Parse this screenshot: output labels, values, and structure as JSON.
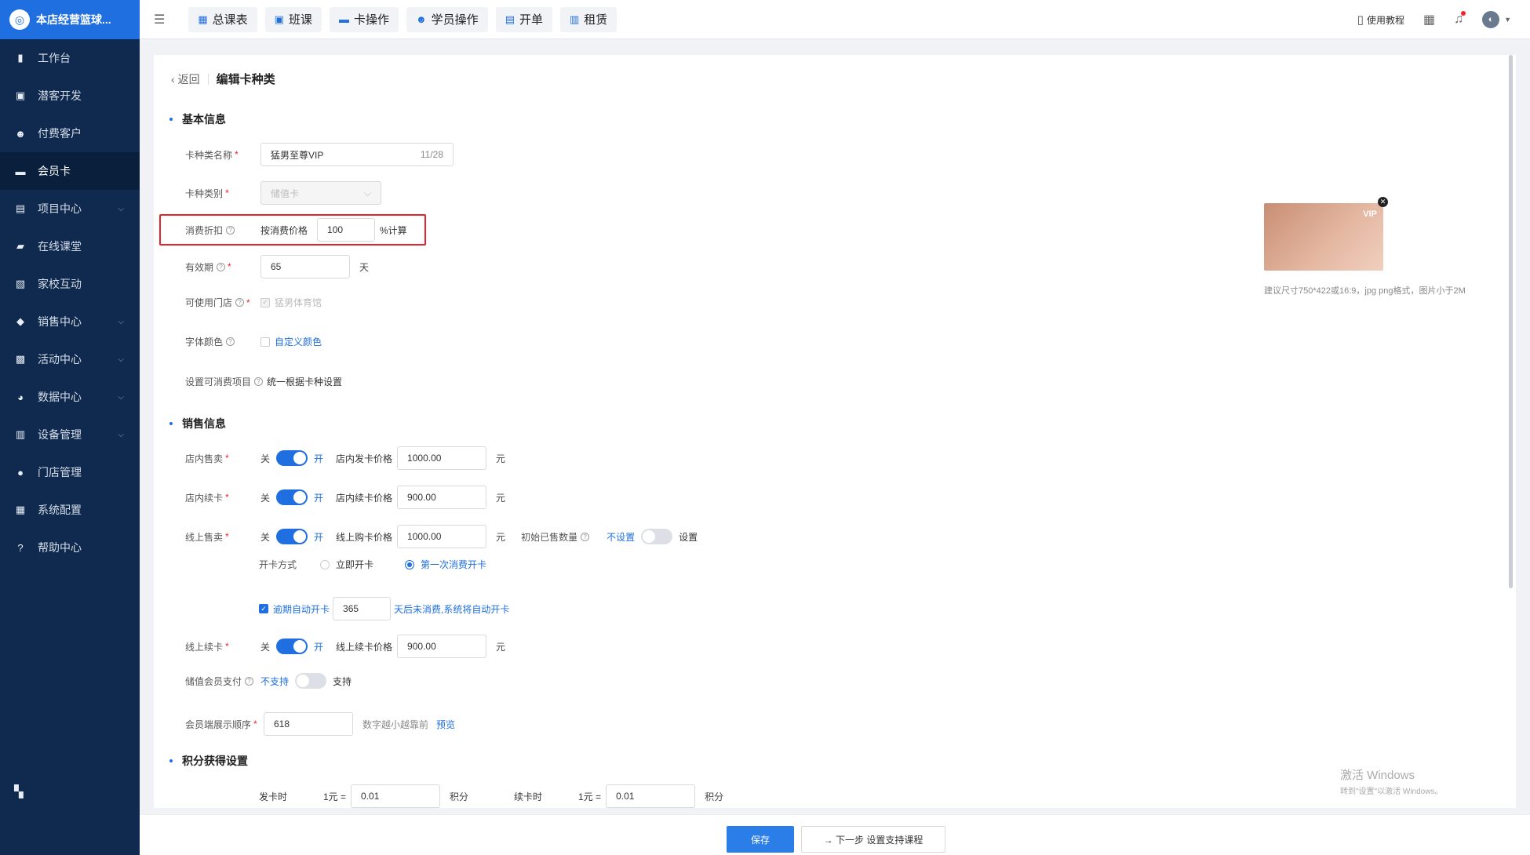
{
  "sidebar": {
    "brand": "本店经营篮球...",
    "items": [
      {
        "label": "工作台",
        "icon": "workbench-icon",
        "chevron": false
      },
      {
        "label": "潜客开发",
        "icon": "prospect-icon",
        "chevron": false
      },
      {
        "label": "付费客户",
        "icon": "customers-icon",
        "chevron": false
      },
      {
        "label": "会员卡",
        "icon": "card-icon",
        "chevron": false,
        "active": true
      },
      {
        "label": "项目中心",
        "icon": "project-icon",
        "chevron": true
      },
      {
        "label": "在线课堂",
        "icon": "classroom-icon",
        "chevron": false
      },
      {
        "label": "家校互动",
        "icon": "interaction-icon",
        "chevron": false
      },
      {
        "label": "销售中心",
        "icon": "sales-icon",
        "chevron": true
      },
      {
        "label": "活动中心",
        "icon": "activity-icon",
        "chevron": true
      },
      {
        "label": "数据中心",
        "icon": "data-icon",
        "chevron": true
      },
      {
        "label": "设备管理",
        "icon": "device-icon",
        "chevron": true
      },
      {
        "label": "门店管理",
        "icon": "store-icon",
        "chevron": false
      },
      {
        "label": "系统配置",
        "icon": "settings-icon",
        "chevron": false
      },
      {
        "label": "帮助中心",
        "icon": "help-icon",
        "chevron": false
      }
    ]
  },
  "header": {
    "tabs": [
      {
        "label": "总课表"
      },
      {
        "label": "班课"
      },
      {
        "label": "卡操作"
      },
      {
        "label": "学员操作"
      },
      {
        "label": "开单"
      },
      {
        "label": "租赁"
      }
    ],
    "tutorial": "使用教程"
  },
  "page": {
    "back": "返回",
    "title": "编辑卡种类"
  },
  "basic": {
    "section": "基本信息",
    "name_label": "卡种类名称",
    "name_value": "猛男至尊VIP",
    "name_count": "11/28",
    "type_label": "卡种类别",
    "type_value": "储值卡",
    "discount_label": "消费折扣",
    "discount_prefix": "按消费价格",
    "discount_value": "100",
    "discount_suffix": "%计算",
    "validity_label": "有效期",
    "validity_value": "65",
    "validity_unit": "天",
    "stores_label": "可使用门店",
    "stores_value": "猛男体育馆",
    "font_color_label": "字体颜色",
    "font_color_value": "自定义颜色",
    "consumable_label": "设置可消费项目",
    "consumable_value": "统一根据卡种设置"
  },
  "card_image": {
    "vip_text": "VIP",
    "hint": "建议尺寸750*422或16:9，jpg png格式，图片小于2M"
  },
  "sales": {
    "section": "销售信息",
    "off": "关",
    "on": "开",
    "yuan": "元",
    "store_sell_label": "店内售卖",
    "store_sell_price_label": "店内发卡价格",
    "store_sell_price": "1000.00",
    "store_renew_label": "店内续卡",
    "store_renew_price_label": "店内续卡价格",
    "store_renew_price": "900.00",
    "online_sell_label": "线上售卖",
    "online_sell_price_label": "线上购卡价格",
    "online_sell_price": "1000.00",
    "initial_sold_label": "初始已售数量",
    "initial_sold_off": "不设置",
    "initial_sold_on": "设置",
    "open_method_label": "开卡方式",
    "open_immediate": "立即开卡",
    "open_first_use": "第一次消费开卡",
    "auto_open_label": "逾期自动开卡",
    "auto_open_days": "365",
    "auto_open_hint": "天后未消费,系统将自动开卡",
    "online_renew_label": "线上续卡",
    "online_renew_price_label": "线上续卡价格",
    "online_renew_price": "900.00",
    "stored_pay_label": "储值会员支付",
    "stored_pay_off": "不支持",
    "stored_pay_on": "支持",
    "display_order_label": "会员端展示顺序",
    "display_order_value": "618",
    "display_order_hint": "数字越小越靠前",
    "display_order_preview": "预览"
  },
  "points": {
    "section": "积分获得设置",
    "issue_label": "发卡时",
    "renew_label": "续卡时",
    "rate_prefix": "1元 =",
    "issue_value": "0.01",
    "renew_value": "0.01",
    "unit": "积分"
  },
  "watermark": {
    "line1": "激活 Windows",
    "line2": "转到\"设置\"以激活 Windows。"
  },
  "footer": {
    "save": "保存",
    "next": "→ 下一步 设置支持课程"
  }
}
